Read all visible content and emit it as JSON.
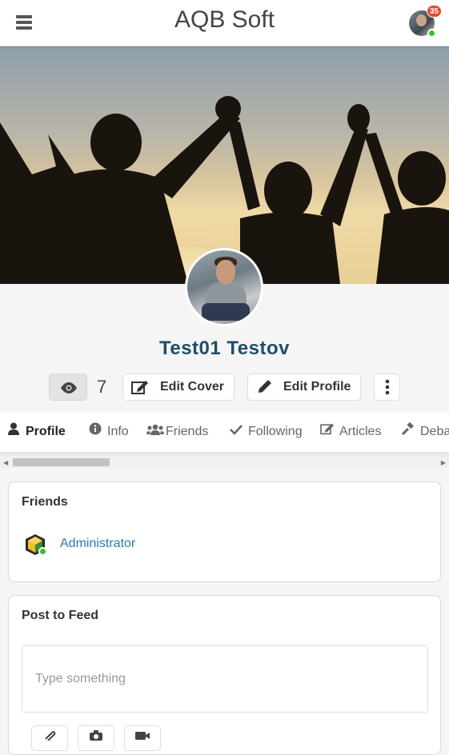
{
  "header": {
    "title": "AQB Soft",
    "menu_icon": "hamburger-icon",
    "notification_count": "35"
  },
  "profile": {
    "name": "Test01 Testov",
    "views": "7",
    "edit_cover_label": "Edit Cover",
    "edit_profile_label": "Edit Profile"
  },
  "tabs": [
    {
      "label": "Profile",
      "icon": "user-icon",
      "active": true
    },
    {
      "label": "Info",
      "icon": "info-icon"
    },
    {
      "label": "Friends",
      "icon": "users-icon"
    },
    {
      "label": "Following",
      "icon": "check-icon"
    },
    {
      "label": "Articles",
      "icon": "edit-icon"
    },
    {
      "label": "Deba",
      "icon": "gavel-icon"
    }
  ],
  "friends": {
    "title": "Friends",
    "items": [
      {
        "name": "Administrator",
        "online": true
      }
    ]
  },
  "post": {
    "title": "Post to Feed",
    "placeholder": "Type something",
    "actions": [
      "attach-icon",
      "camera-icon",
      "video-icon"
    ]
  },
  "colors": {
    "accent_name": "#1d4f67",
    "badge": "#e8492c",
    "online": "#35c22e",
    "link": "#2a7ab3"
  }
}
